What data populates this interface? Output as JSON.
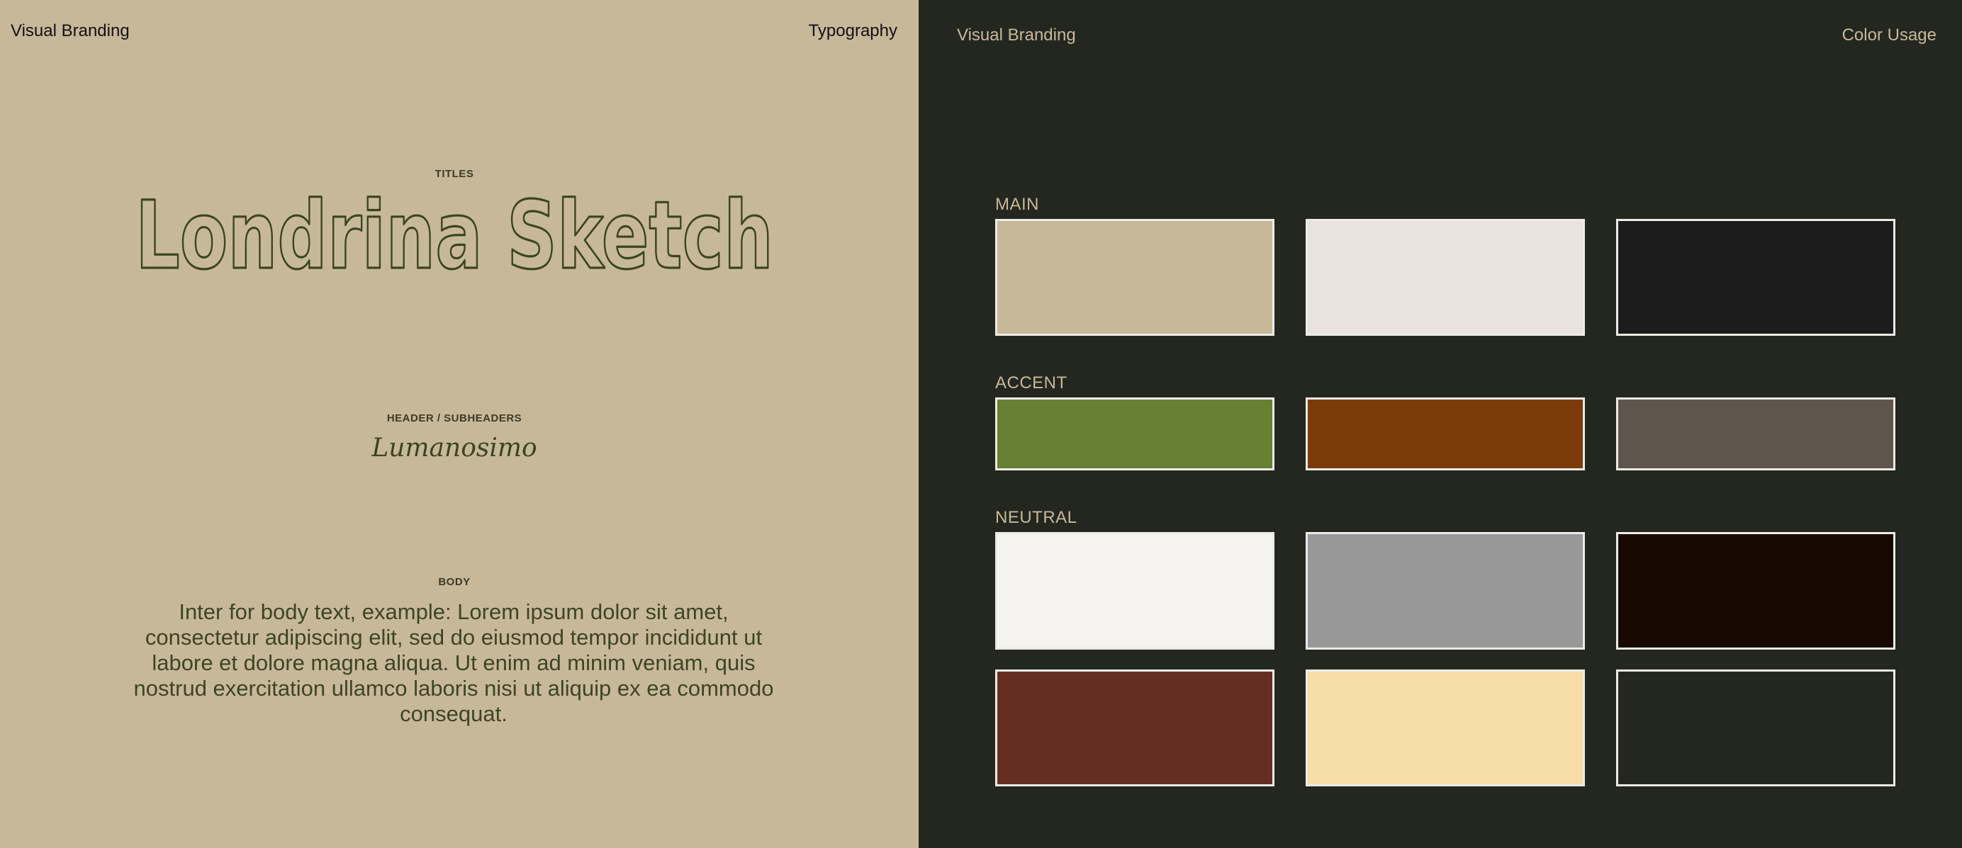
{
  "left_panel": {
    "header_left": "Visual Branding",
    "header_right": "Typography",
    "titles_caption": "TITLES",
    "titles_font": "Londrina Sketch",
    "header_caption": "HEADER / SUBHEADERS",
    "header_font": "Lumanosimo",
    "body_caption": "BODY",
    "body_sample": "Inter for body text, example: Lorem ipsum dolor sit amet, consectetur adipiscing elit, sed do eiusmod tempor incididunt ut labore et dolore magna aliqua. Ut enim ad minim veniam, quis nostrud exercitation ullamco laboris nisi ut aliquip ex ea commodo consequat."
  },
  "right_panel": {
    "header_left": "Visual Branding",
    "header_right": "Color Usage",
    "groups": [
      {
        "label": "MAIN",
        "colors": [
          "#C8B89A",
          "#E8E3DC",
          "#1C1C1C"
        ]
      },
      {
        "label": "ACCENT",
        "colors": [
          "#688033",
          "#7C3B0B",
          "#5E554D"
        ]
      },
      {
        "label": "NEUTRAL",
        "colors": [
          "#F5F4F1",
          "#989898",
          "#170902",
          "#642E23",
          "#F6DCA6",
          "#23271F"
        ]
      }
    ]
  }
}
